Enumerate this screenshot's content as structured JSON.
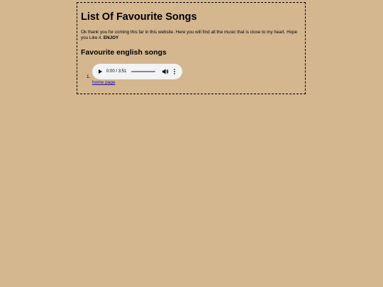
{
  "page": {
    "title": "List Of Favourite Songs",
    "intro_text": "Ok thank you for coming this far in this website. Here you will find all the music that is close to my heart. Hope you Like it.",
    "intro_emphasis": "ENJOY",
    "section_heading": "Favourite english songs"
  },
  "playlist": {
    "items": [
      {
        "number": "1.",
        "player": {
          "time": "0:00 / 3:51",
          "progress": 0,
          "play_icon": "play-icon",
          "volume_icon": "volume-icon",
          "menu_icon": "more-vertical-icon"
        }
      }
    ],
    "home_link": "home page"
  },
  "colors": {
    "background": "#d4b68f",
    "player_bg": "#f1f3f4",
    "link": "#1a0dab"
  }
}
